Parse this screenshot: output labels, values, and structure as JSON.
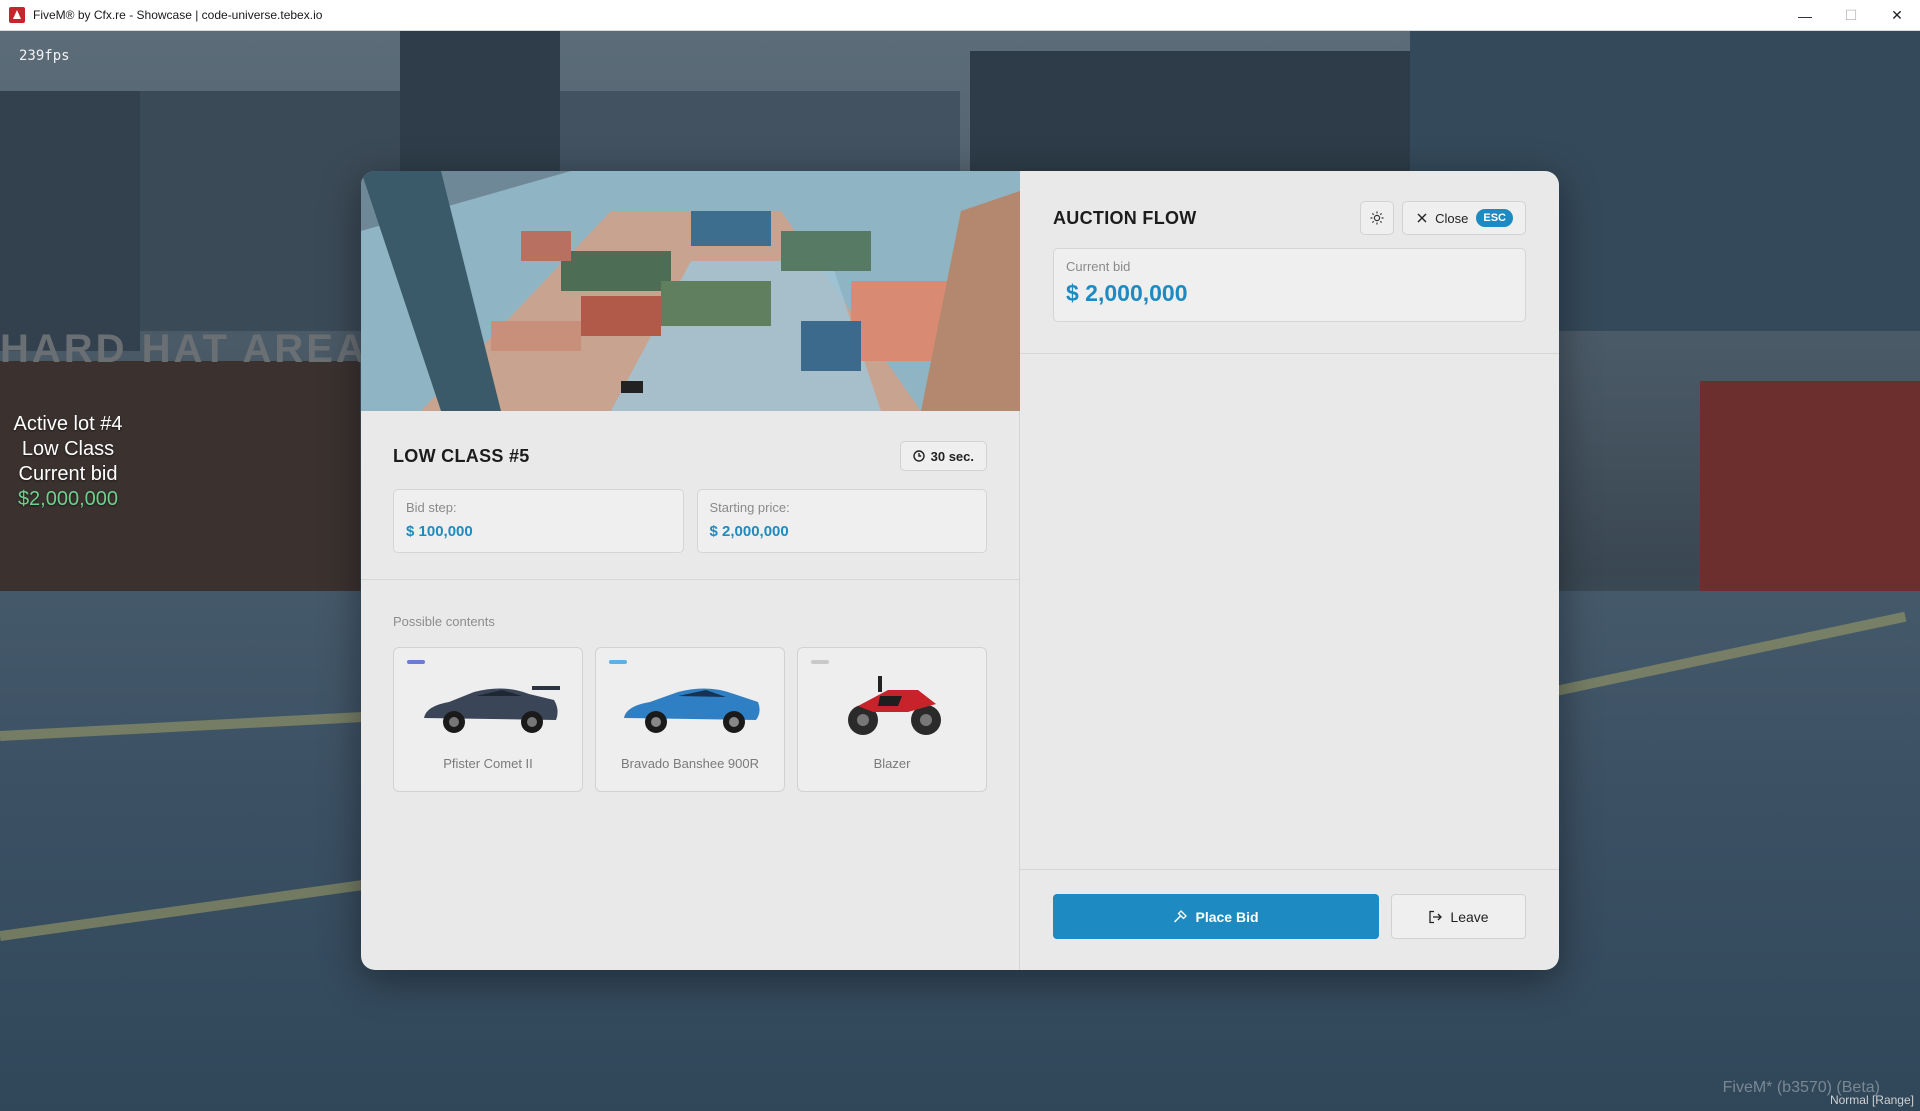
{
  "window": {
    "title": "FiveM® by Cfx.re - Showcase | code-universe.tebex.io",
    "minimize": "—",
    "maximize": "☐",
    "close": "✕"
  },
  "hud": {
    "fps": "239fps",
    "line1": "Active lot #4",
    "line2": "Low Class",
    "line3": "Current bid",
    "line4": "$2,000,000",
    "sign": "HARD HAT AREA",
    "watermark": "FiveM* (b3570) (Beta)",
    "watermark_sub": "Normal [Range]"
  },
  "lot": {
    "title": "LOW CLASS #5",
    "timer": "30 sec.",
    "bid_step_label": "Bid step:",
    "bid_step_value": "$ 100,000",
    "start_label": "Starting price:",
    "start_value": "$ 2,000,000",
    "contents_label": "Possible contents",
    "items": [
      {
        "name": "Pfister Comet II",
        "tag_color": "#6b7bd6",
        "body_color": "#3a4658"
      },
      {
        "name": "Bravado Banshee 900R",
        "tag_color": "#5db0e6",
        "body_color": "#2f7fc4"
      },
      {
        "name": "Blazer",
        "tag_color": "#c9c9c9",
        "body_color": "#c8222a"
      }
    ]
  },
  "auction": {
    "title": "AUCTION FLOW",
    "close_label": "Close",
    "esc_label": "ESC",
    "current_bid_label": "Current bid",
    "current_bid_value": "$ 2,000,000",
    "place_bid_label": "Place Bid",
    "leave_label": "Leave"
  },
  "colors": {
    "accent": "#1d8bc1",
    "hud_bid": "#6fd08c"
  }
}
